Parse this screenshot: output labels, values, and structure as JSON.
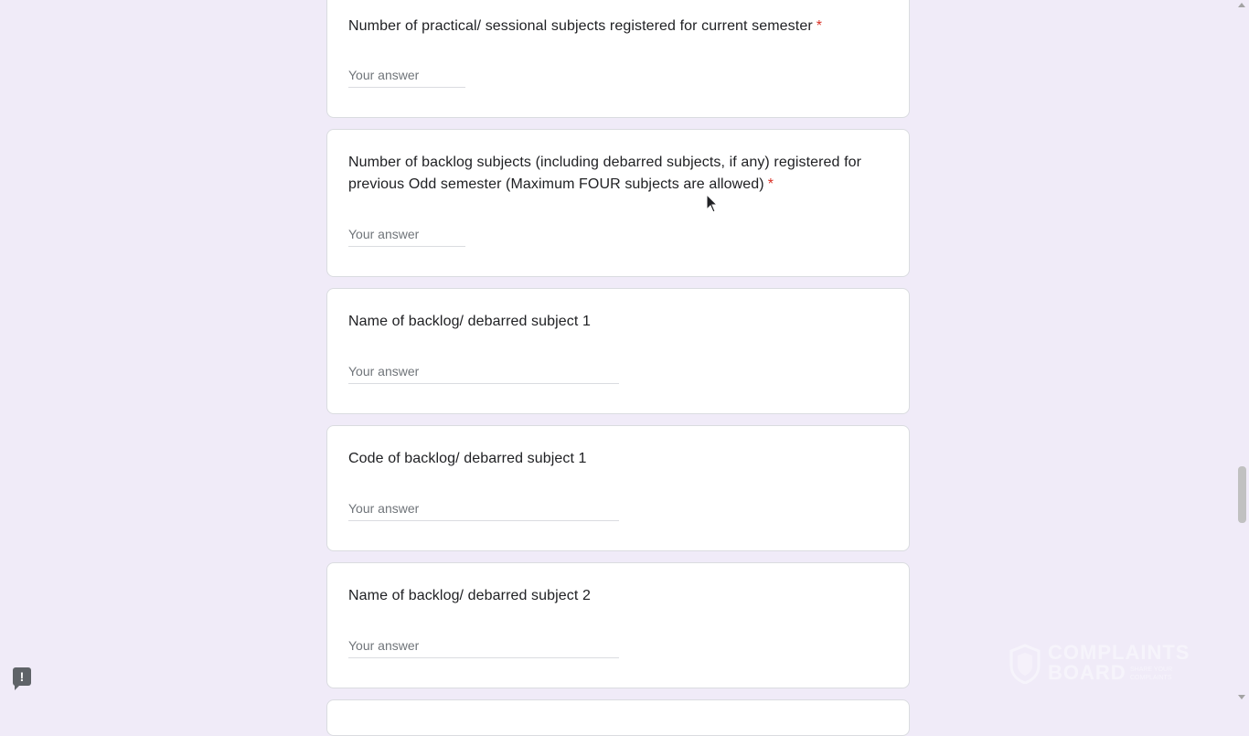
{
  "questions": [
    {
      "title": "Number of practical/ sessional subjects registered for current semester",
      "required_mark": "*",
      "placeholder": "Your answer"
    },
    {
      "title": "Number of backlog subjects (including debarred subjects, if any) registered for previous Odd semester (Maximum FOUR subjects are allowed)",
      "required_mark": "*",
      "placeholder": "Your answer"
    },
    {
      "title": "Name of backlog/ debarred subject 1",
      "placeholder": "Your answer"
    },
    {
      "title": "Code of backlog/ debarred subject 1",
      "placeholder": "Your answer"
    },
    {
      "title": "Name of backlog/ debarred subject 2",
      "placeholder": "Your answer"
    }
  ],
  "feedback": {
    "icon": "report-icon",
    "glyph": "!"
  },
  "watermark": {
    "line1": "COMPLAINTS",
    "line2": "BOARD",
    "tagline": "SHARE YOUR COMPLAINTS"
  },
  "colors": {
    "background": "#f0ebf8",
    "card": "#ffffff",
    "required": "#d93025",
    "text": "#202124"
  }
}
